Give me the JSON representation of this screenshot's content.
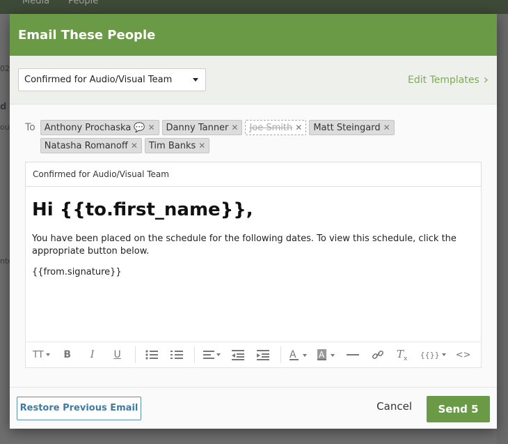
{
  "background": {
    "nav": [
      "Media",
      "People"
    ],
    "left_fragments": [
      "02",
      "d",
      "ou",
      "nte"
    ]
  },
  "modal": {
    "title": "Email These People",
    "template": {
      "selected": "Confirmed for Audio/Visual Team",
      "edit_label": "Edit Templates"
    },
    "to_label": "To",
    "recipients": [
      {
        "name": "Anthony Prochaska",
        "has_message_icon": true,
        "excluded": false
      },
      {
        "name": "Danny Tanner",
        "excluded": false
      },
      {
        "name": "Joe Smith",
        "excluded": true
      },
      {
        "name": "Matt Steingard",
        "excluded": false
      },
      {
        "name": "Natasha Romanoff",
        "excluded": false
      },
      {
        "name": "Tim Banks",
        "excluded": false
      }
    ],
    "subject": "Confirmed for Audio/Visual Team",
    "body": {
      "greeting": "Hi {{to.first_name}},",
      "paragraph": "You have been placed on the schedule for the following dates. To view this schedule, click the appropriate button below.",
      "signature": "{{from.signature}}"
    },
    "toolbar": {
      "font_size": "TT",
      "bold": "B",
      "italic": "I",
      "underline": "U",
      "template_vars": "{{}}",
      "code": "<>"
    },
    "footer": {
      "restore_label": "Restore Previous Email",
      "cancel_label": "Cancel",
      "send_label": "Send 5"
    }
  },
  "colors": {
    "brand_green": "#6b9a46",
    "link_green": "#7eaa56",
    "restore_blue": "#3f7aa3"
  }
}
